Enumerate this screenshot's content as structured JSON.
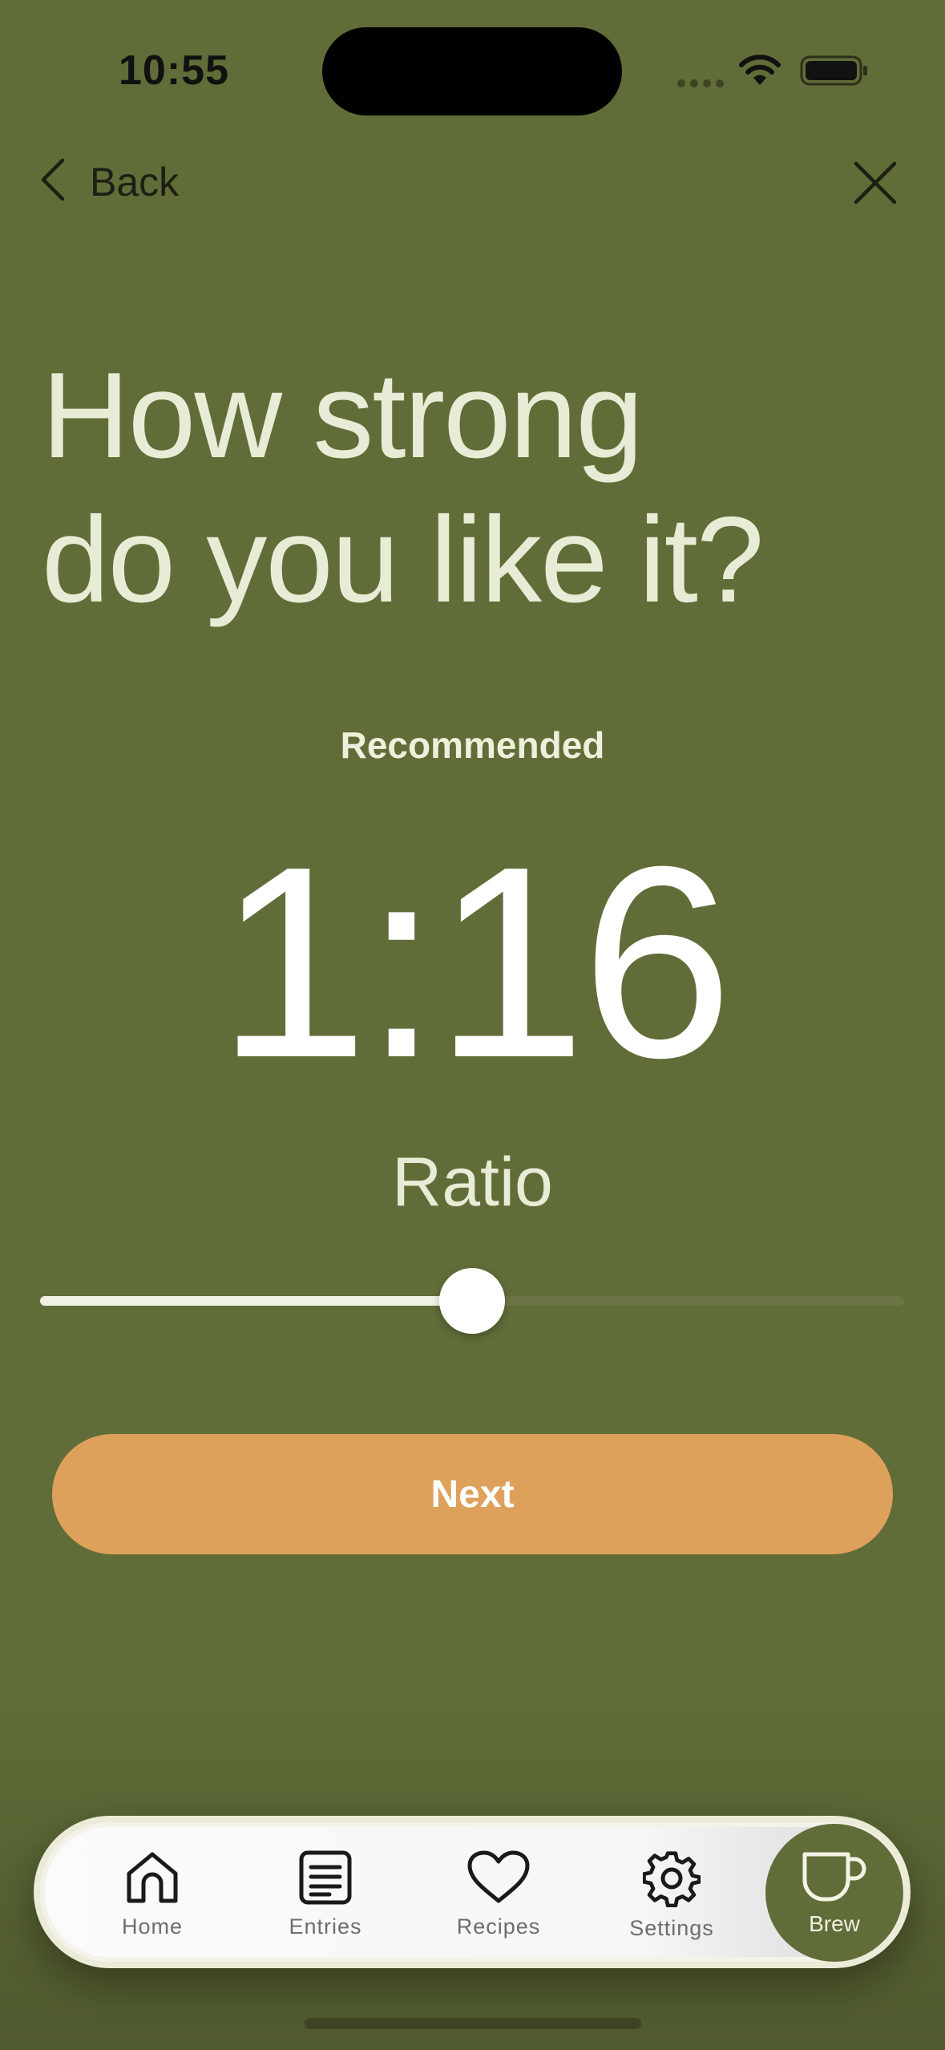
{
  "status_bar": {
    "time": "10:55"
  },
  "nav": {
    "back_label": "Back"
  },
  "headline": {
    "line1": "How strong",
    "line2": "do you like it?"
  },
  "ratio": {
    "recommended_label": "Recommended",
    "value": "1:16",
    "label": "Ratio",
    "slider_level": 0.5
  },
  "actions": {
    "next_label": "Next"
  },
  "tabbar": {
    "items": [
      {
        "label": "Home",
        "icon": "house-icon"
      },
      {
        "label": "Entries",
        "icon": "list-icon"
      },
      {
        "label": "Recipes",
        "icon": "heart-icon"
      },
      {
        "label": "Settings",
        "icon": "gear-icon"
      },
      {
        "label": "Brew",
        "icon": "cup-icon"
      }
    ]
  },
  "colors": {
    "background": "#606d38",
    "accent_button": "#dea15c",
    "headline_text": "#e8ecd6"
  }
}
